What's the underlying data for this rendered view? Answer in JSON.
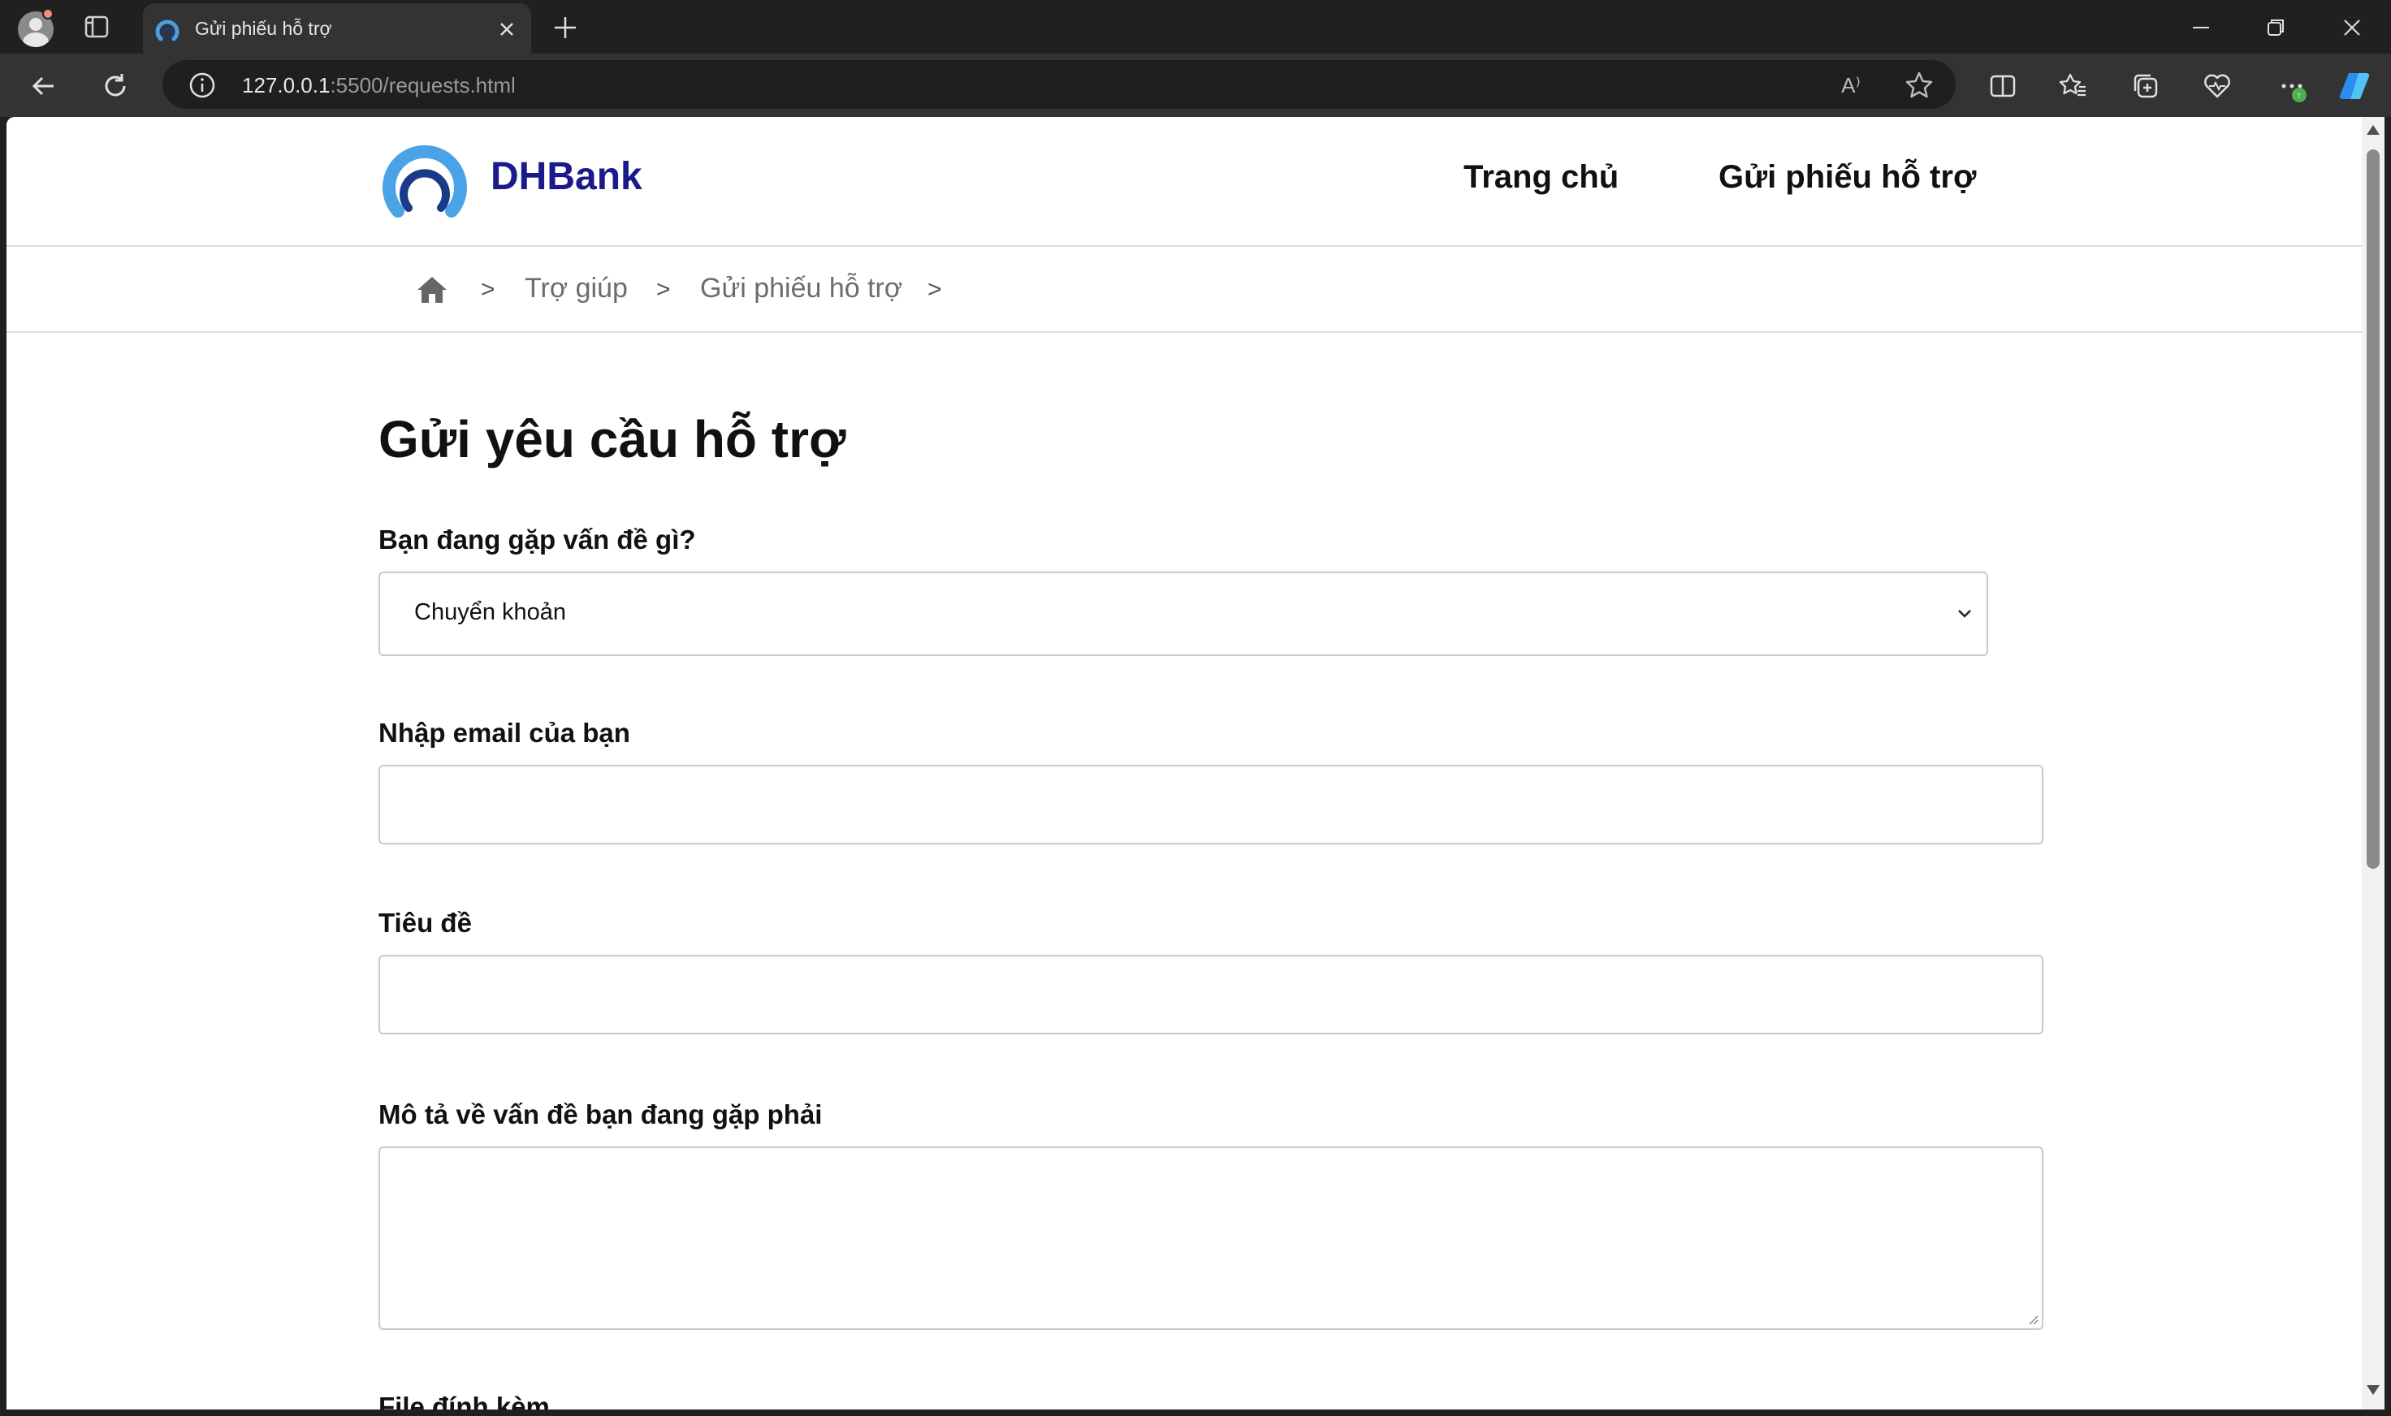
{
  "browser": {
    "tab_title": "Gửi phiếu hỗ trợ",
    "url_host": "127.0.0.1",
    "url_rest": ":5500/requests.html",
    "read_aloud_glyph": "A⁾"
  },
  "header": {
    "brand": "DHBank",
    "nav": [
      "Trang chủ",
      "Gửi phiếu hỗ trợ"
    ]
  },
  "breadcrumb": {
    "separator": ">",
    "items": [
      "Trợ giúp",
      "Gửi phiếu hỗ trợ"
    ]
  },
  "form": {
    "title": "Gửi yêu cầu hỗ trợ",
    "issue_label": "Bạn đang gặp vấn đề gì?",
    "issue_value": "Chuyển khoản",
    "email_label": "Nhập email của bạn",
    "email_value": "",
    "subject_label": "Tiêu đề",
    "subject_value": "",
    "description_label": "Mô tả về vấn đề bạn đang gặp phải",
    "description_value": "",
    "attachment_label": "File đính kèm"
  },
  "colors": {
    "brand": "#1b1a8a",
    "logo_blue": "#2f8fd6",
    "logo_dark": "#1a3a8a"
  }
}
